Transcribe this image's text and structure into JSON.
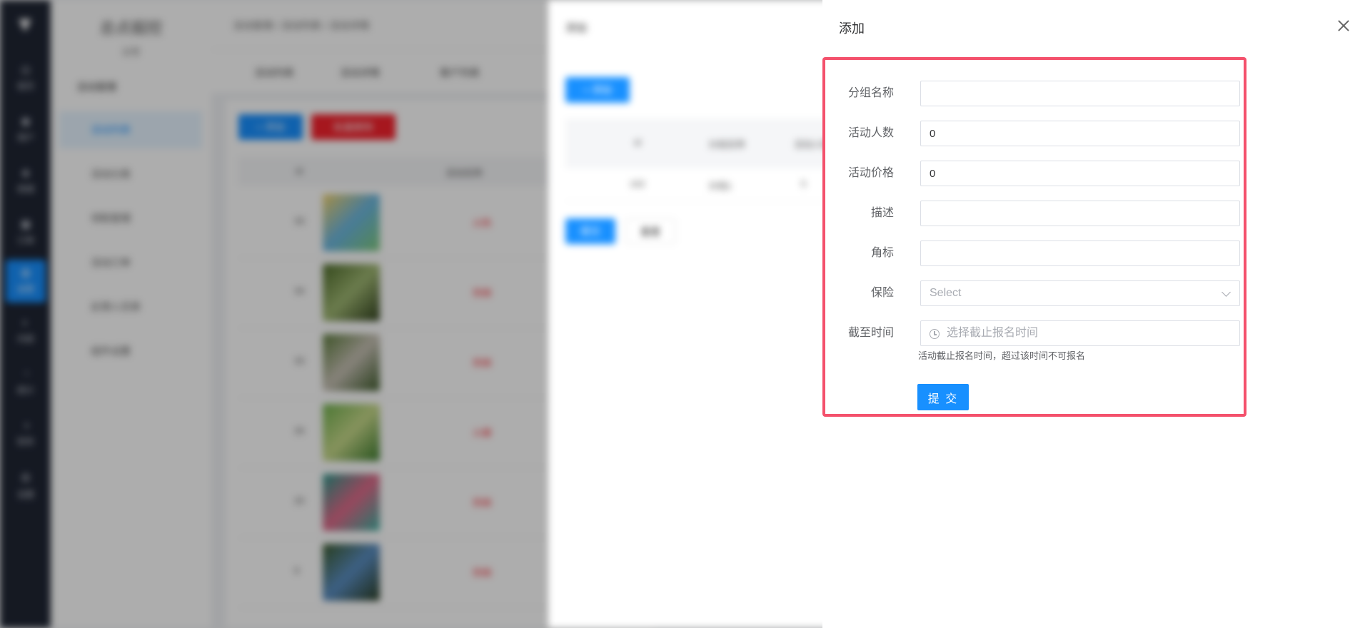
{
  "background": {
    "app_title": "总点掘控",
    "app_subtitle": "运营",
    "side_icons": [
      "首页",
      "用户",
      "商城",
      "订单",
      "运营",
      "内容",
      "统计",
      "财务",
      "设置"
    ],
    "menu_group": "活动管理",
    "menu_items": [
      "活动列表",
      "活动分类",
      "领取管理",
      "活动订单",
      "反馈人员表",
      "组件设置"
    ],
    "breadcrumb": "活动管理 / 活动列表 / 活动详情",
    "tabs": [
      "活动列表",
      "活动详情",
      "客户列表"
    ],
    "add_label": "+ 添加",
    "batch_delete_label": "批量删除",
    "column_id": "id",
    "column_name": "活动名称",
    "rows": [
      {
        "id": "33",
        "tag": "火热"
      },
      {
        "id": "34",
        "tag": "热销"
      },
      {
        "id": "33",
        "tag": "热销"
      },
      {
        "id": "26",
        "tag": "火爆"
      },
      {
        "id": "20",
        "tag": "热销"
      },
      {
        "id": "9",
        "tag": "热销"
      }
    ]
  },
  "drawer1": {
    "title": "添加",
    "add_button": "+ 添加",
    "columns": [
      "id",
      "分组名称",
      "活动人数"
    ],
    "row": [
      "162",
      "分组1",
      "5"
    ],
    "submit": "提交",
    "reset": "重置"
  },
  "drawer2": {
    "title": "添加",
    "fields": {
      "group_name": {
        "label": "分组名称",
        "value": ""
      },
      "participants": {
        "label": "活动人数",
        "value": "0"
      },
      "price": {
        "label": "活动价格",
        "value": "0"
      },
      "description": {
        "label": "描述",
        "value": ""
      },
      "badge": {
        "label": "角标",
        "value": ""
      },
      "insurance": {
        "label": "保险",
        "placeholder": "Select"
      },
      "deadline": {
        "label": "截至时间",
        "placeholder": "选择截止报名时间"
      }
    },
    "deadline_help": "活动截止报名时间，超过该时间不可报名",
    "submit_label": "提 交"
  },
  "colors": {
    "primary": "#1890ff",
    "highlight_border": "#f4516c",
    "sidebar": "#1f2533"
  }
}
